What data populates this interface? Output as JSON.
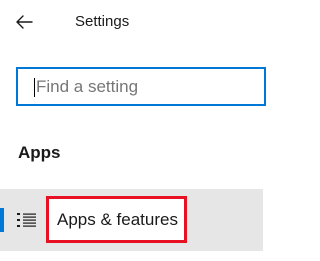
{
  "header": {
    "back_icon": "arrow-left-icon",
    "title": "Settings"
  },
  "search": {
    "value": "",
    "placeholder": "Find a setting"
  },
  "section": {
    "heading": "Apps"
  },
  "nav": {
    "items": [
      {
        "icon": "apps-list-icon",
        "label": "Apps & features",
        "selected": true
      }
    ]
  },
  "colors": {
    "accent": "#0078d7",
    "highlight_border": "#e81123",
    "selected_background": "#e6e6e6",
    "placeholder_text": "#767676"
  }
}
